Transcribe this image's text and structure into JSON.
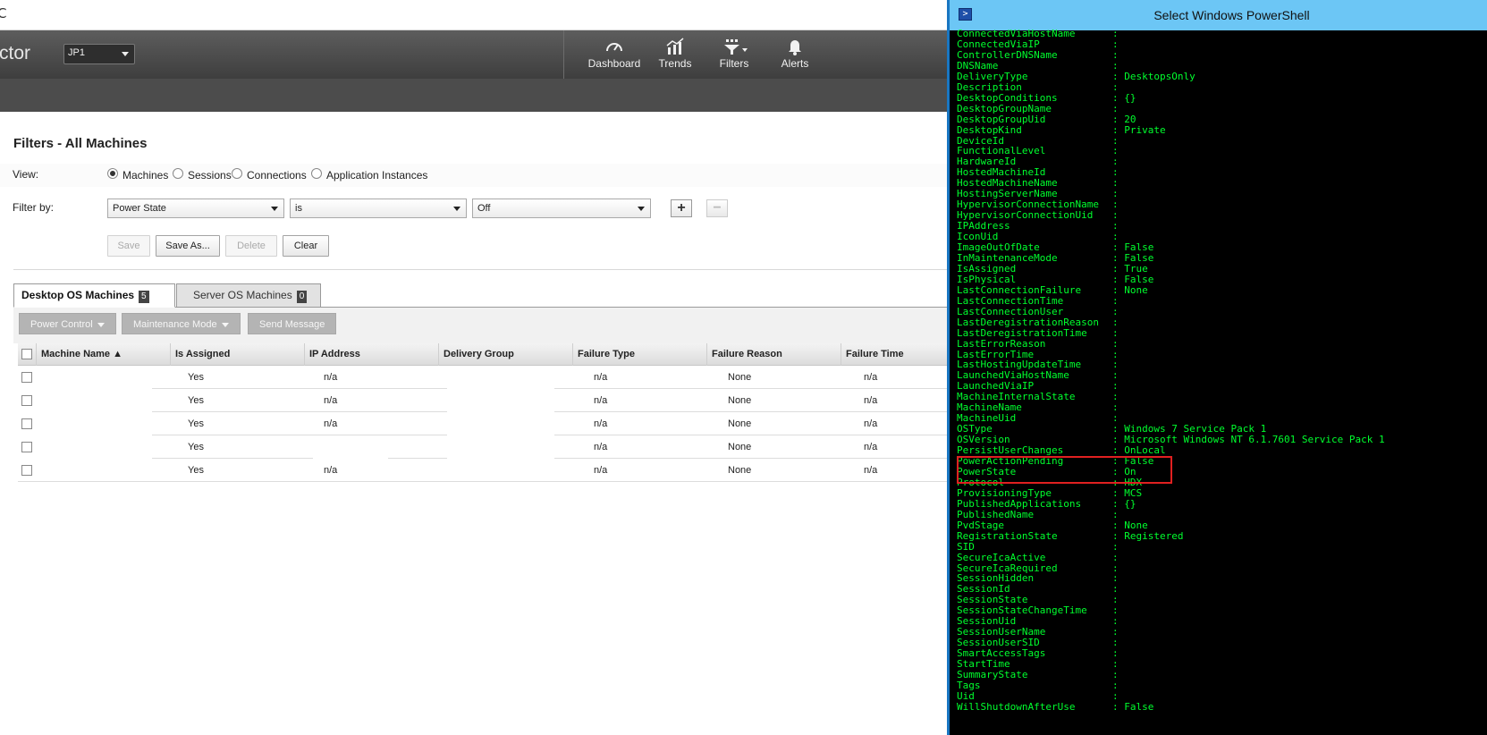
{
  "browser": {
    "refresh_glyph": "C"
  },
  "app": {
    "logo_text": "ctor",
    "site": "JP1"
  },
  "nav": [
    {
      "label": "Dashboard",
      "icon": "dashboard-icon"
    },
    {
      "label": "Trends",
      "icon": "trends-icon"
    },
    {
      "label": "Filters",
      "icon": "filters-icon"
    },
    {
      "label": "Alerts",
      "icon": "bell-icon"
    }
  ],
  "page": {
    "title": "Filters - All Machines",
    "view_label": "View:",
    "view_options": [
      "Machines",
      "Sessions",
      "Connections",
      "Application Instances"
    ],
    "view_selected": "Machines",
    "filter_label": "Filter by:",
    "filter": {
      "field": "Power State",
      "operator": "is",
      "value": "Off"
    },
    "add_symbol": "+",
    "remove_symbol": "−",
    "buttons": {
      "save": "Save",
      "save_as": "Save As...",
      "delete": "Delete",
      "clear": "Clear"
    }
  },
  "tabs": [
    {
      "label": "Desktop OS Machines",
      "count": "5",
      "active": true
    },
    {
      "label": "Server OS Machines",
      "count": "0",
      "active": false
    }
  ],
  "actions": {
    "power_control": "Power Control",
    "maintenance_mode": "Maintenance Mode",
    "send_message": "Send Message"
  },
  "table": {
    "columns": [
      "Machine Name",
      "Is Assigned",
      "IP Address",
      "Delivery Group",
      "Failure Type",
      "Failure Reason",
      "Failure Time"
    ],
    "rows": [
      {
        "machine": "",
        "assigned": "Yes",
        "ip": "n/a",
        "group": "",
        "type": "n/a",
        "reason": "None",
        "time": "n/a"
      },
      {
        "machine": "",
        "assigned": "Yes",
        "ip": "n/a",
        "group": "",
        "type": "n/a",
        "reason": "None",
        "time": "n/a"
      },
      {
        "machine": "",
        "assigned": "Yes",
        "ip": "n/a",
        "group": "",
        "type": "n/a",
        "reason": "None",
        "time": "n/a"
      },
      {
        "machine": "",
        "assigned": "Yes",
        "ip": "",
        "group": "",
        "type": "n/a",
        "reason": "None",
        "time": "n/a"
      },
      {
        "machine": "",
        "assigned": "Yes",
        "ip": "n/a",
        "group": "",
        "type": "n/a",
        "reason": "None",
        "time": "n/a"
      }
    ]
  },
  "powershell": {
    "title": "Select Windows PowerShell",
    "icon": "powershell-icon",
    "text_color": "#00ff2e",
    "highlight_color": "#e02020",
    "lines": [
      [
        "ConnectedViaHostName",
        ":"
      ],
      [
        "ConnectedViaIP",
        ":"
      ],
      [
        "ControllerDNSName",
        ":"
      ],
      [
        "DNSName",
        ":"
      ],
      [
        "DeliveryType",
        ": DesktopsOnly"
      ],
      [
        "Description",
        ":"
      ],
      [
        "DesktopConditions",
        ": {}"
      ],
      [
        "DesktopGroupName",
        ":"
      ],
      [
        "DesktopGroupUid",
        ": 20"
      ],
      [
        "DesktopKind",
        ": Private"
      ],
      [
        "DeviceId",
        ":"
      ],
      [
        "FunctionalLevel",
        ":"
      ],
      [
        "HardwareId",
        ":"
      ],
      [
        "HostedMachineId",
        ":"
      ],
      [
        "HostedMachineName",
        ":"
      ],
      [
        "HostingServerName",
        ":"
      ],
      [
        "HypervisorConnectionName",
        ":"
      ],
      [
        "HypervisorConnectionUid",
        ":"
      ],
      [
        "IPAddress",
        ":"
      ],
      [
        "IconUid",
        ":"
      ],
      [
        "ImageOutOfDate",
        ": False"
      ],
      [
        "InMaintenanceMode",
        ": False"
      ],
      [
        "IsAssigned",
        ": True"
      ],
      [
        "IsPhysical",
        ": False"
      ],
      [
        "LastConnectionFailure",
        ": None"
      ],
      [
        "LastConnectionTime",
        ":"
      ],
      [
        "LastConnectionUser",
        ":"
      ],
      [
        "LastDeregistrationReason",
        ":"
      ],
      [
        "LastDeregistrationTime",
        ":"
      ],
      [
        "LastErrorReason",
        ":"
      ],
      [
        "LastErrorTime",
        ":"
      ],
      [
        "LastHostingUpdateTime",
        ":"
      ],
      [
        "LaunchedViaHostName",
        ":"
      ],
      [
        "LaunchedViaIP",
        ":"
      ],
      [
        "MachineInternalState",
        ":"
      ],
      [
        "MachineName",
        ":"
      ],
      [
        "MachineUid",
        ":"
      ],
      [
        "OSType",
        ": Windows 7 Service Pack 1"
      ],
      [
        "OSVersion",
        ": Microsoft Windows NT 6.1.7601 Service Pack 1"
      ],
      [
        "PersistUserChanges",
        ": OnLocal"
      ],
      [
        "PowerActionPending",
        ": False"
      ],
      [
        "PowerState",
        ": On"
      ],
      [
        "Protocol",
        ": HDX"
      ],
      [
        "ProvisioningType",
        ": MCS"
      ],
      [
        "PublishedApplications",
        ": {}"
      ],
      [
        "PublishedName",
        ":"
      ],
      [
        "PvdStage",
        ": None"
      ],
      [
        "RegistrationState",
        ": Registered"
      ],
      [
        "SID",
        ":"
      ],
      [
        "SecureIcaActive",
        ":"
      ],
      [
        "SecureIcaRequired",
        ":"
      ],
      [
        "SessionHidden",
        ":"
      ],
      [
        "SessionId",
        ":"
      ],
      [
        "SessionState",
        ":"
      ],
      [
        "SessionStateChangeTime",
        ":"
      ],
      [
        "SessionUid",
        ":"
      ],
      [
        "SessionUserName",
        ":"
      ],
      [
        "SessionUserSID",
        ":"
      ],
      [
        "SmartAccessTags",
        ":"
      ],
      [
        "StartTime",
        ":"
      ],
      [
        "SummaryState",
        ":"
      ],
      [
        "Tags",
        ":"
      ],
      [
        "Uid",
        ":"
      ],
      [
        "WillShutdownAfterUse",
        ": False"
      ]
    ]
  }
}
